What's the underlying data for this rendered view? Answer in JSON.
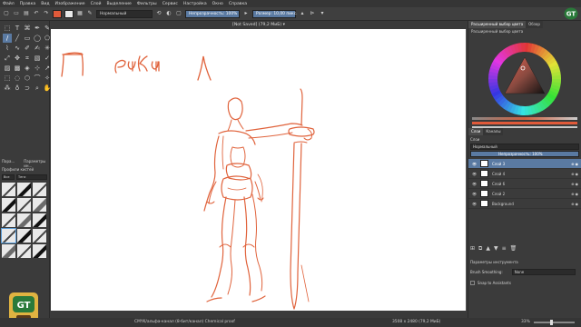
{
  "menu": [
    "Файл",
    "Правка",
    "Вид",
    "Изображение",
    "Слой",
    "Выделение",
    "Фильтры",
    "Сервис",
    "Настройка",
    "Окно",
    "Справка"
  ],
  "toolbar": {
    "fg_color": "#e05a3a",
    "bg_color": "#e9e9e9",
    "blend_mode": "Нормальный",
    "opacity": "Непрозрачность: 100%",
    "size": "Размер: 10,00 пикс."
  },
  "canvas": {
    "title": "[Not Saved]  (79,2 MиБ) ▾",
    "handwriting": [
      "П",
      "руки",
      "л"
    ],
    "stroke_color": "#e0633c"
  },
  "toolbox": {
    "options_tabs": [
      "Пара...",
      "Параметры ин..."
    ],
    "brushes_title": "Профили кистей",
    "brush_filter": [
      "Все",
      "Теги"
    ]
  },
  "docker": {
    "tabs": [
      "Расширенный выбор цвета",
      "Обзор"
    ],
    "selector_label": "Расширенный выбор цвета",
    "layers_tabs": [
      "Слои",
      "Каналы"
    ],
    "layers_header": "Слои",
    "blend": "Нормальный",
    "opacity": "Непрозрачность: 100%",
    "layers": [
      {
        "name": "Слой 3",
        "selected": true
      },
      {
        "name": "Слой 4",
        "selected": false
      },
      {
        "name": "Слой 6",
        "selected": false
      },
      {
        "name": "Слой 2",
        "selected": false
      },
      {
        "name": "Background",
        "selected": false
      }
    ],
    "tool_options_header": "Параметры инструмента",
    "smoothing_label": "Brush Smoothing:",
    "smoothing_value": "None",
    "snap_label": "Snap to Assistants"
  },
  "status": {
    "color_space": "CMYK/альфа-канал (8-бит/канал)  Chemical proof",
    "size": "3508 x 2480 (79,2 MиБ)",
    "zoom": "33%"
  }
}
